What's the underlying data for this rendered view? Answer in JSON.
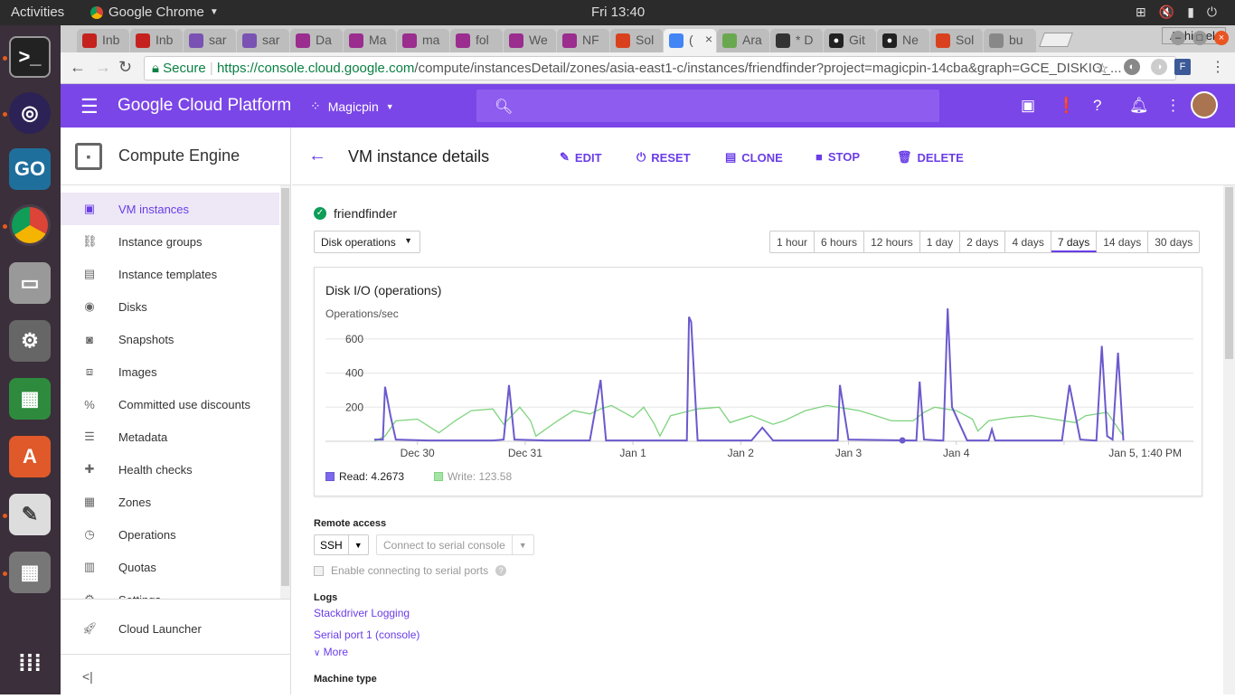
{
  "topbar": {
    "activities": "Activities",
    "app": "Google Chrome",
    "clock": "Fri 13:40"
  },
  "tabs": [
    {
      "label": "Inb",
      "icon": "gmail-icon",
      "color": "#c5221f"
    },
    {
      "label": "Inb",
      "icon": "gmail-icon",
      "color": "#c5221f"
    },
    {
      "label": "sar",
      "icon": "bootstrap-icon",
      "color": "#7952b3"
    },
    {
      "label": "sar",
      "icon": "bootstrap-icon",
      "color": "#7952b3"
    },
    {
      "label": "Da",
      "icon": "heroku-icon",
      "color": "#9b2d8f"
    },
    {
      "label": "Ma",
      "icon": "heroku-icon",
      "color": "#9b2d8f"
    },
    {
      "label": "ma",
      "icon": "heroku-icon",
      "color": "#9b2d8f"
    },
    {
      "label": "fol",
      "icon": "heroku-icon",
      "color": "#9b2d8f"
    },
    {
      "label": "We",
      "icon": "heroku-icon",
      "color": "#9b2d8f"
    },
    {
      "label": "NF",
      "icon": "heroku-icon",
      "color": "#9b2d8f"
    },
    {
      "label": "Sol",
      "icon": "solr-icon",
      "color": "#d9411e"
    },
    {
      "label": "(",
      "icon": "gcp-icon",
      "color": "#4285f4"
    },
    {
      "label": "Ara",
      "icon": "eye-icon",
      "color": "#6aa84f"
    },
    {
      "label": "* D",
      "icon": "clock-icon",
      "color": "#333333"
    },
    {
      "label": "Git",
      "icon": "github-icon",
      "color": "#222222"
    },
    {
      "label": "Ne",
      "icon": "github-icon",
      "color": "#222222"
    },
    {
      "label": "Sol",
      "icon": "solr-icon",
      "color": "#d9411e"
    },
    {
      "label": "bu",
      "icon": "document-icon",
      "color": "#888888"
    }
  ],
  "user_chip": "Abhishek",
  "address": {
    "secure": "Secure",
    "url_host": "https://console.cloud.google.com",
    "url_path": "/compute/instancesDetail/zones/asia-east1-c/instances/friendfinder?project=magicpin-14cba&graph=GCE_DISKIO_..."
  },
  "gcp": {
    "brand": "Google Cloud Platform",
    "project": "Magicpin",
    "accent": "#7b46e8"
  },
  "sidebar": {
    "title": "Compute Engine",
    "items": [
      {
        "label": "VM instances",
        "icon": "vm-icon"
      },
      {
        "label": "Instance groups",
        "icon": "groups-icon"
      },
      {
        "label": "Instance templates",
        "icon": "template-icon"
      },
      {
        "label": "Disks",
        "icon": "disk-icon"
      },
      {
        "label": "Snapshots",
        "icon": "snapshot-icon"
      },
      {
        "label": "Images",
        "icon": "image-icon"
      },
      {
        "label": "Committed use discounts",
        "icon": "percent-icon"
      },
      {
        "label": "Metadata",
        "icon": "list-icon"
      },
      {
        "label": "Health checks",
        "icon": "health-icon"
      },
      {
        "label": "Zones",
        "icon": "zones-icon"
      },
      {
        "label": "Operations",
        "icon": "clock-icon"
      },
      {
        "label": "Quotas",
        "icon": "quota-icon"
      },
      {
        "label": "Settings",
        "icon": "gear-icon"
      }
    ],
    "footer": "Cloud Launcher",
    "collapse": "<|"
  },
  "page": {
    "title": "VM instance details",
    "actions": [
      {
        "label": "EDIT",
        "icon": "pencil-icon"
      },
      {
        "label": "RESET",
        "icon": "power-icon"
      },
      {
        "label": "CLONE",
        "icon": "copy-icon"
      },
      {
        "label": "STOP",
        "icon": "stop-icon"
      },
      {
        "label": "DELETE",
        "icon": "trash-icon"
      }
    ],
    "instance_name": "friendfinder",
    "metric_select": "Disk operations",
    "ranges": [
      "1 hour",
      "6 hours",
      "12 hours",
      "1 day",
      "2 days",
      "4 days",
      "7 days",
      "14 days",
      "30 days"
    ],
    "selected_range": "7 days",
    "remote_access": "Remote access",
    "ssh": "SSH",
    "serial": "Connect to serial console",
    "serial_checkbox": "Enable connecting to serial ports",
    "logs": "Logs",
    "log_links": [
      "Stackdriver Logging",
      "Serial port 1 (console)"
    ],
    "more": "More",
    "machine_type": "Machine type"
  },
  "chart_data": {
    "type": "line",
    "title": "Disk I/O (operations)",
    "ylabel": "Operations/sec",
    "y_ticks": [
      200,
      400,
      600
    ],
    "ylim": [
      0,
      780
    ],
    "xlim": [
      0,
      7.6
    ],
    "x_tick_labels": [
      {
        "x": 0.4,
        "label": "Dec 30"
      },
      {
        "x": 1.4,
        "label": "Dec 31"
      },
      {
        "x": 2.4,
        "label": "Jan 1"
      },
      {
        "x": 3.4,
        "label": "Jan 2"
      },
      {
        "x": 4.4,
        "label": "Jan 3"
      },
      {
        "x": 5.4,
        "label": "Jan 4"
      },
      {
        "x": 6.4,
        "label": "Jan 5, 1:40 PM"
      }
    ],
    "series": [
      {
        "name": "Read",
        "legend": "Read: 4.2673",
        "color": "#6a5acd",
        "x": [
          0,
          0.08,
          0.1,
          0.15,
          0.2,
          0.5,
          1.1,
          1.2,
          1.25,
          1.3,
          1.6,
          2.0,
          2.1,
          2.15,
          2.8,
          2.9,
          2.92,
          2.94,
          3.0,
          3.5,
          3.6,
          3.7,
          4.2,
          4.3,
          4.32,
          4.4,
          5.0,
          5.03,
          5.06,
          5.1,
          5.25,
          5.28,
          5.32,
          5.36,
          5.5,
          5.7,
          5.73,
          5.76,
          6.3,
          6.38,
          6.45,
          6.55,
          6.68,
          6.7,
          6.75,
          6.8,
          6.85,
          6.9,
          6.95
        ],
        "y": [
          10,
          10,
          320,
          150,
          10,
          5,
          5,
          10,
          330,
          10,
          5,
          5,
          360,
          5,
          5,
          5,
          730,
          700,
          5,
          5,
          80,
          5,
          5,
          5,
          330,
          10,
          5,
          5,
          350,
          10,
          5,
          5,
          780,
          200,
          5,
          5,
          70,
          5,
          5,
          5,
          330,
          10,
          5,
          5,
          560,
          30,
          10,
          520,
          5
        ]
      },
      {
        "name": "Write",
        "legend": "Write: 123.58",
        "color": "#7ed37e",
        "x": [
          0,
          0.1,
          0.2,
          0.4,
          0.6,
          0.75,
          0.9,
          1.1,
          1.2,
          1.35,
          1.45,
          1.5,
          1.7,
          1.85,
          2.0,
          2.1,
          2.2,
          2.4,
          2.5,
          2.6,
          2.65,
          2.75,
          3.0,
          3.2,
          3.3,
          3.5,
          3.7,
          3.8,
          4.0,
          4.2,
          4.4,
          4.5,
          4.6,
          4.8,
          5.0,
          5.1,
          5.2,
          5.4,
          5.55,
          5.6,
          5.7,
          5.9,
          6.1,
          6.3,
          6.5,
          6.6,
          6.8,
          6.95
        ],
        "y": [
          0,
          30,
          120,
          130,
          50,
          120,
          180,
          190,
          100,
          200,
          120,
          30,
          120,
          180,
          160,
          190,
          210,
          140,
          200,
          100,
          30,
          150,
          190,
          200,
          110,
          150,
          100,
          120,
          180,
          210,
          190,
          180,
          160,
          120,
          120,
          170,
          200,
          180,
          130,
          60,
          120,
          140,
          150,
          130,
          110,
          150,
          170,
          30
        ]
      }
    ]
  }
}
